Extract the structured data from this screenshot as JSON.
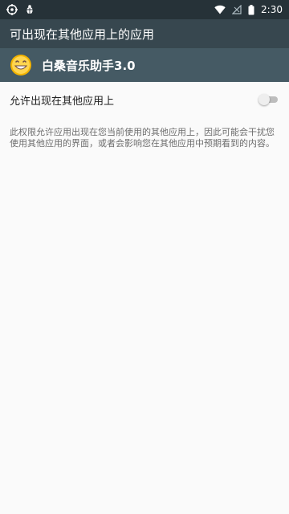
{
  "statusbar": {
    "time": "2:30",
    "icons_left": [
      "target-icon",
      "bug-icon"
    ],
    "icons_right": [
      "wifi-icon",
      "no-signal-icon",
      "battery-icon"
    ]
  },
  "appbar": {
    "title": "可出现在其他应用上的应用"
  },
  "app": {
    "name": "白桑音乐助手3.0",
    "icon_name": "smiley-face-icon"
  },
  "setting": {
    "label": "允许出现在其他应用上",
    "toggle_state": "off"
  },
  "description": "此权限允许应用出现在您当前使用的其他应用上，因此可能会干扰您使用其他应用的界面，或者会影响您在其他应用中预期看到的内容。",
  "colors": {
    "statusbar_bg": "#263238",
    "appbar_bg": "#37474f",
    "app_row_bg": "#455a64",
    "content_bg": "#fafafa",
    "desc_text": "#6d6d6d"
  }
}
